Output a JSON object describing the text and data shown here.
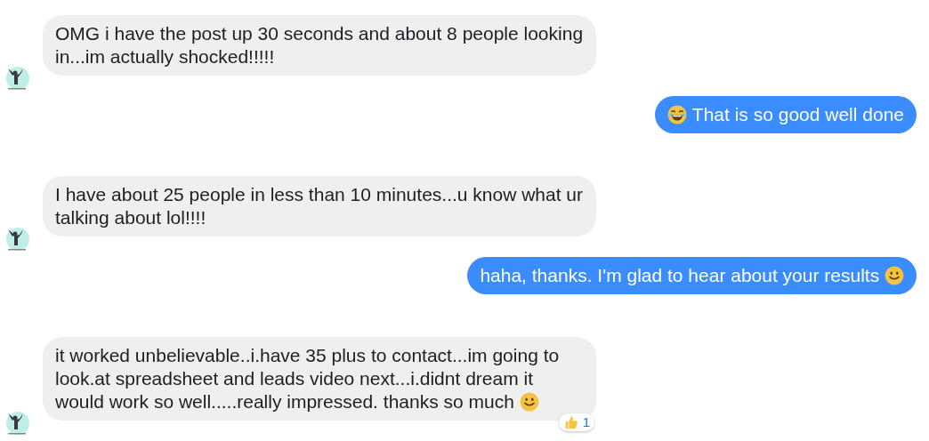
{
  "messages": [
    {
      "kind": "received",
      "text": "OMG i have the post up 30 seconds and about 8 people looking in...im actually shocked!!!!!"
    },
    {
      "kind": "sent",
      "leading_emoji": {
        "kind": "laugh"
      },
      "text": "That is so good well done"
    },
    {
      "kind": "received",
      "text": "I have about 25 people in less than 10 minutes...u know what ur talking about lol!!!!"
    },
    {
      "kind": "sent",
      "text": "haha, thanks. I'm glad to hear about your results",
      "trailing_emoji": {
        "kind": "smile"
      }
    },
    {
      "kind": "received",
      "text": "it worked unbelievable..i.have 35 plus to contact...im going to look.at spreadsheet and leads video next...i.didnt dream it would work so well.....really impressed. thanks so much",
      "trailing_emoji": {
        "kind": "smile"
      },
      "reaction": {
        "kind": "like",
        "count": "1"
      }
    }
  ]
}
